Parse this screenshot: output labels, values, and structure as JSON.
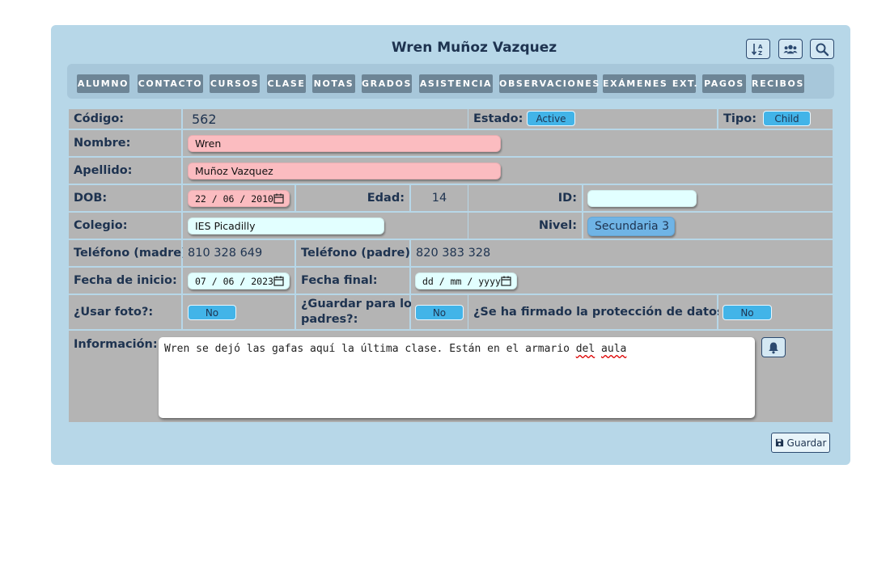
{
  "header": {
    "title": "Wren Muñoz Vazquez",
    "tools": [
      {
        "icon": "sort-az-icon"
      },
      {
        "icon": "users-icon"
      },
      {
        "icon": "search-icon"
      }
    ]
  },
  "nav": {
    "tabs": [
      "ALUMNO",
      "CONTACTO",
      "CURSOS",
      "CLASE",
      "NOTAS",
      "GRADOS",
      "ASISTENCIA",
      "OBSERVACIONES",
      "EXÁMENES EXT.",
      "PAGOS",
      "RECIBOS"
    ]
  },
  "form": {
    "codigo_label": "Código:",
    "codigo_value": "562",
    "estado_label": "Estado:",
    "estado_value": "Active",
    "tipo_label": "Tipo:",
    "tipo_value": "Child",
    "nombre_label": "Nombre:",
    "nombre_value": "Wren",
    "apellido_label": "Apellido:",
    "apellido_value": "Muñoz Vazquez",
    "dob_label": "DOB:",
    "dob_value": "22 / 06 / 2010",
    "edad_label": "Edad:",
    "edad_value": "14",
    "id_label": "ID:",
    "id_value": "",
    "colegio_label": "Colegio:",
    "colegio_value": "IES Picadilly",
    "nivel_label": "Nivel:",
    "nivel_value": "Secundaria 3",
    "tel_madre_label": "Teléfono (madre):",
    "tel_madre_value": "810 328 649",
    "tel_padre_label": "Teléfono (padre):",
    "tel_padre_value": "820 383 328",
    "fecha_inicio_label": "Fecha de inicio:",
    "fecha_inicio_value": "07 / 06 / 2023",
    "fecha_final_label": "Fecha final:",
    "fecha_final_value": "dd / mm / yyyy",
    "usar_foto_label": "¿Usar foto?:",
    "usar_foto_value": "No",
    "guardar_padres_label_1": "¿Guardar para los",
    "guardar_padres_label_2": "padres?:",
    "guardar_padres_value": "No",
    "proteccion_label": "¿Se ha firmado la protección de datos?:",
    "proteccion_value": "No",
    "informacion_label": "Información:",
    "informacion_text_1": "Wren se dejó las gafas aquí la última clase. Están en el armario ",
    "informacion_text_2": "del",
    "informacion_text_3": " ",
    "informacion_text_4": "aula"
  },
  "footer": {
    "save_label": "Guardar"
  },
  "colors": {
    "panel": "#b7d7e8",
    "cell": "#b4b4b4",
    "nav_button": "#6d8596",
    "pill": "#42b4e8",
    "pink_field": "#fbbcc0",
    "cyan_field": "#e2ffff"
  }
}
